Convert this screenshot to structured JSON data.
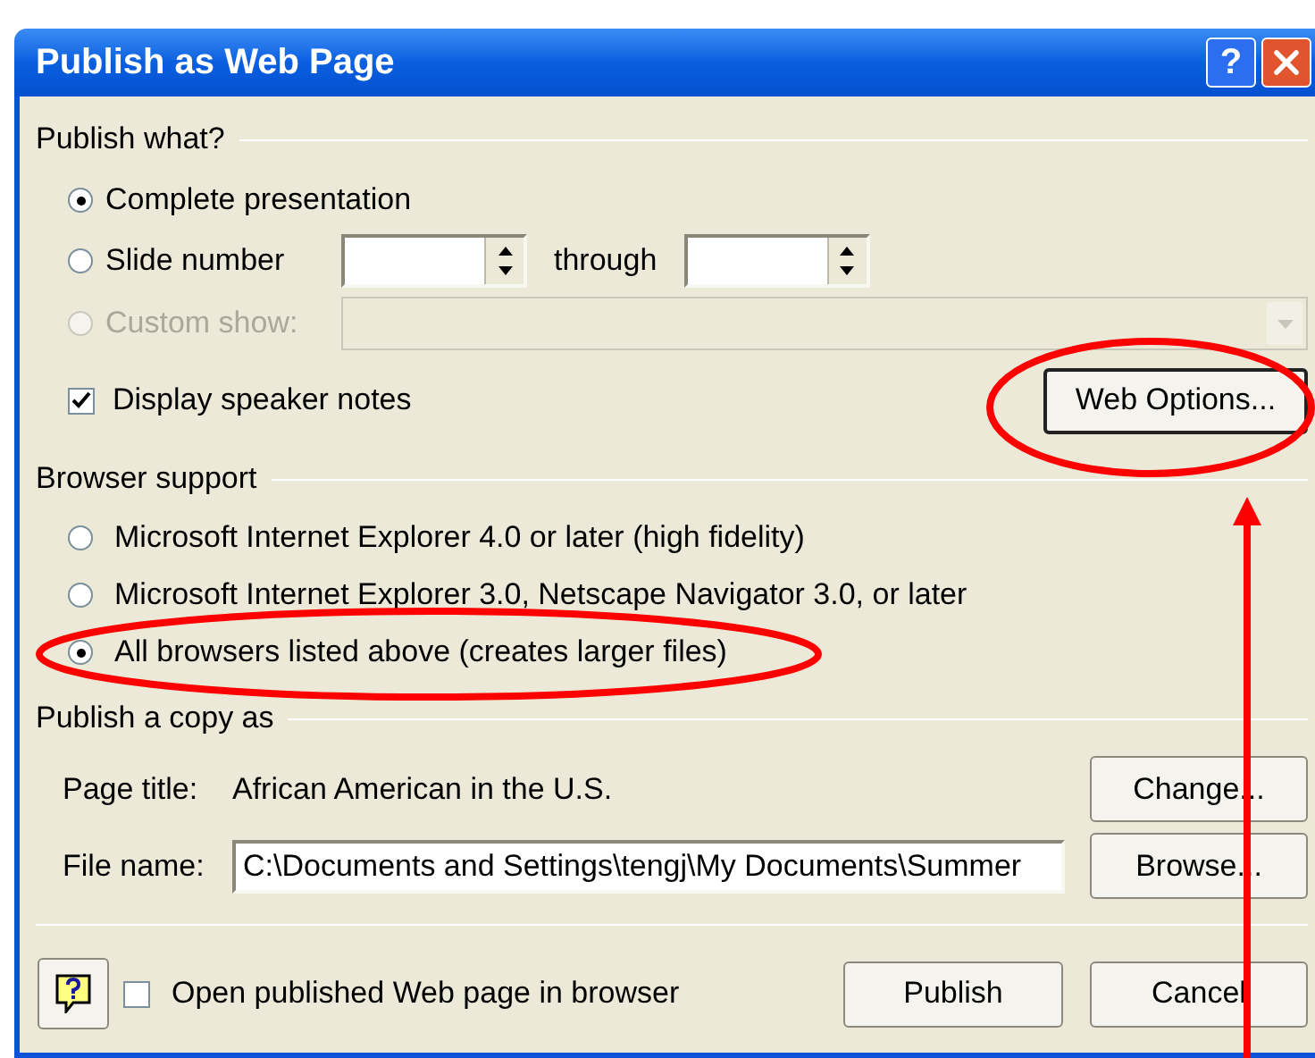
{
  "window": {
    "title": "Publish as Web Page",
    "help_button": "?"
  },
  "publish_what": {
    "legend": "Publish what?",
    "options": [
      {
        "kind": "plain",
        "label": "Complete presentation",
        "selected": true,
        "disabled": false
      },
      {
        "kind": "range",
        "label": "Slide number",
        "selected": false,
        "disabled": false
      },
      {
        "kind": "dropdown",
        "label": "Custom show:",
        "selected": false,
        "disabled": true
      }
    ],
    "through_label": "through",
    "speaker_notes": {
      "label": "Display speaker notes",
      "checked": true
    },
    "web_options_button": "Web Options..."
  },
  "browser_support": {
    "legend": "Browser support",
    "options": [
      {
        "label": "Microsoft Internet Explorer 4.0 or later (high fidelity)",
        "selected": false
      },
      {
        "label": "Microsoft Internet Explorer 3.0, Netscape Navigator 3.0, or later",
        "selected": false
      },
      {
        "label": "All browsers listed above (creates larger files)",
        "selected": true
      }
    ]
  },
  "publish_copy": {
    "legend": "Publish a copy as",
    "page_title_label": "Page title:",
    "page_title": "African American in the U.S.",
    "file_name_label": "File name:",
    "file_name": "C:\\Documents and Settings\\tengj\\My Documents\\Summer",
    "change_button": "Change...",
    "browse_button": "Browse..."
  },
  "footer": {
    "open_in_browser": {
      "label": "Open published Web page in browser",
      "checked": false
    },
    "publish_button": "Publish",
    "cancel_button": "Cancel"
  }
}
